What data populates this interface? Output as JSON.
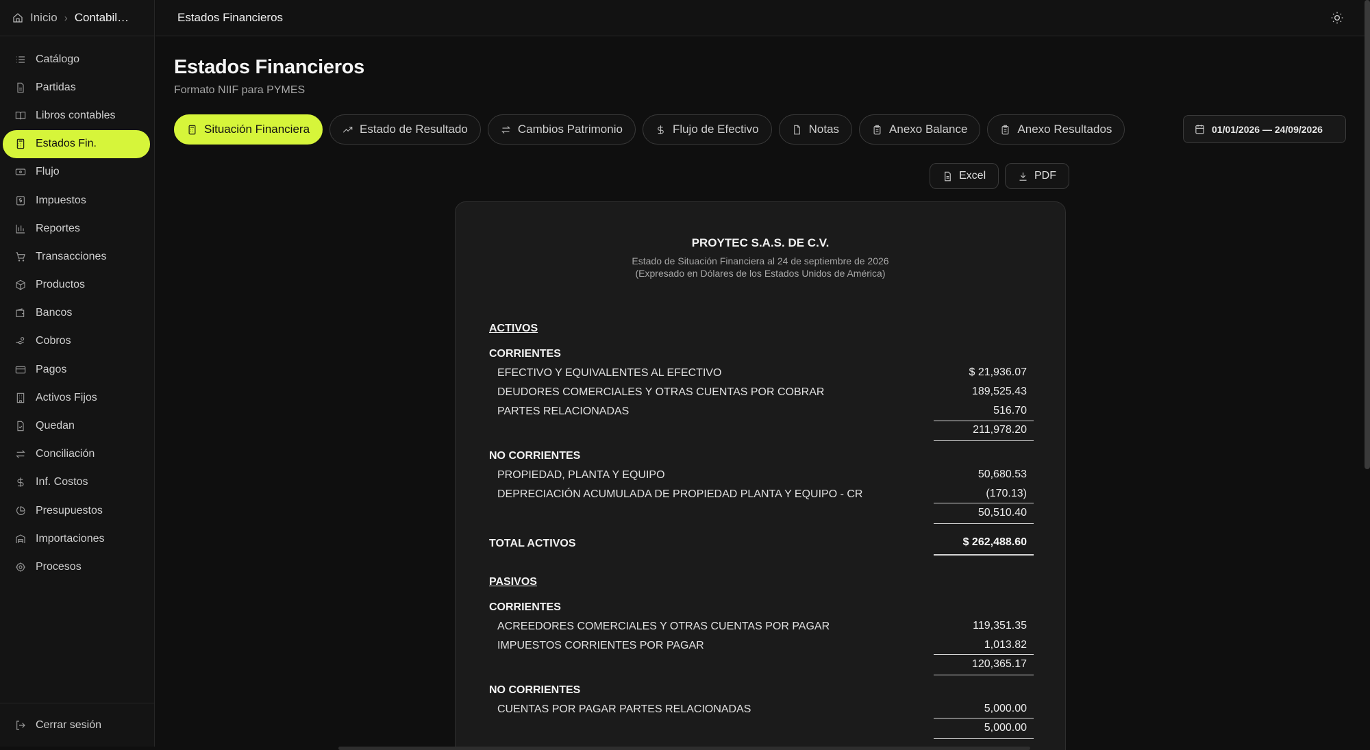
{
  "breadcrumb": {
    "home": "Inicio",
    "current": "Contabilidad"
  },
  "sidebar": {
    "items": [
      {
        "label": "Catálogo",
        "icon": "list-icon"
      },
      {
        "label": "Partidas",
        "icon": "file-text-icon"
      },
      {
        "label": "Libros contables",
        "icon": "book-icon"
      },
      {
        "label": "Estados Fin.",
        "icon": "calculator-icon",
        "active": true
      },
      {
        "label": "Flujo",
        "icon": "banknote-icon"
      },
      {
        "label": "Impuestos",
        "icon": "receipt-icon"
      },
      {
        "label": "Reportes",
        "icon": "bar-chart-icon"
      },
      {
        "label": "Transacciones",
        "icon": "cart-icon"
      },
      {
        "label": "Productos",
        "icon": "package-icon"
      },
      {
        "label": "Bancos",
        "icon": "wallet-icon"
      },
      {
        "label": "Cobros",
        "icon": "hand-coins-icon"
      },
      {
        "label": "Pagos",
        "icon": "credit-card-icon"
      },
      {
        "label": "Activos Fijos",
        "icon": "building-icon"
      },
      {
        "label": "Quedan",
        "icon": "file-check-icon"
      },
      {
        "label": "Conciliación",
        "icon": "arrows-exchange-icon"
      },
      {
        "label": "Inf. Costos",
        "icon": "dollar-icon"
      },
      {
        "label": "Presupuestos",
        "icon": "pie-chart-icon"
      },
      {
        "label": "Importaciones",
        "icon": "warehouse-icon"
      },
      {
        "label": "Procesos",
        "icon": "cog-icon"
      }
    ],
    "logout": "Cerrar sesión"
  },
  "topbar": {
    "title": "Estados Financieros"
  },
  "page": {
    "title": "Estados Financieros",
    "subtitle": "Formato NIIF para PYMES"
  },
  "tabs": [
    {
      "label": "Situación Financiera",
      "active": true
    },
    {
      "label": "Estado de Resultado"
    },
    {
      "label": "Cambios Patrimonio"
    },
    {
      "label": "Flujo de Efectivo"
    },
    {
      "label": "Notas"
    },
    {
      "label": "Anexo Balance"
    },
    {
      "label": "Anexo Resultados"
    }
  ],
  "date_range": "01/01/2026 — 24/09/2026",
  "export": {
    "excel": "Excel",
    "pdf": "PDF"
  },
  "colors": {
    "accent": "#d6f53a",
    "background": "#0f0f0f",
    "panel": "#1b1b1b"
  },
  "report": {
    "company": "PROYTEC S.A.S. DE C.V.",
    "statement": "Estado de Situación Financiera al 24 de septiembre de 2026",
    "currency": "(Expresado en Dólares de los Estados Unidos de América)",
    "assets": {
      "title": "ACTIVOS",
      "current_title": "CORRIENTES",
      "current": [
        {
          "label": "EFECTIVO Y EQUIVALENTES AL EFECTIVO",
          "amount": "$ 21,936.07"
        },
        {
          "label": "DEUDORES COMERCIALES Y OTRAS CUENTAS POR COBRAR",
          "amount": "189,525.43"
        },
        {
          "label": "PARTES RELACIONADAS",
          "amount": "516.70"
        }
      ],
      "current_subtotal": "211,978.20",
      "noncurrent_title": "NO CORRIENTES",
      "noncurrent": [
        {
          "label": "PROPIEDAD, PLANTA Y EQUIPO",
          "amount": "50,680.53"
        },
        {
          "label": "DEPRECIACIÓN ACUMULADA DE PROPIEDAD PLANTA Y EQUIPO - CR",
          "amount": "(170.13)"
        }
      ],
      "noncurrent_subtotal": "50,510.40",
      "total_label": "TOTAL ACTIVOS",
      "total": "$ 262,488.60"
    },
    "liabilities": {
      "title": "PASIVOS",
      "current_title": "CORRIENTES",
      "current": [
        {
          "label": "ACREEDORES COMERCIALES Y OTRAS CUENTAS POR PAGAR",
          "amount": "119,351.35"
        },
        {
          "label": "IMPUESTOS CORRIENTES POR PAGAR",
          "amount": "1,013.82"
        }
      ],
      "current_subtotal": "120,365.17",
      "noncurrent_title": "NO CORRIENTES",
      "noncurrent": [
        {
          "label": "CUENTAS POR PAGAR PARTES RELACIONADAS",
          "amount": "5,000.00"
        }
      ],
      "noncurrent_subtotal": "5,000.00"
    }
  }
}
